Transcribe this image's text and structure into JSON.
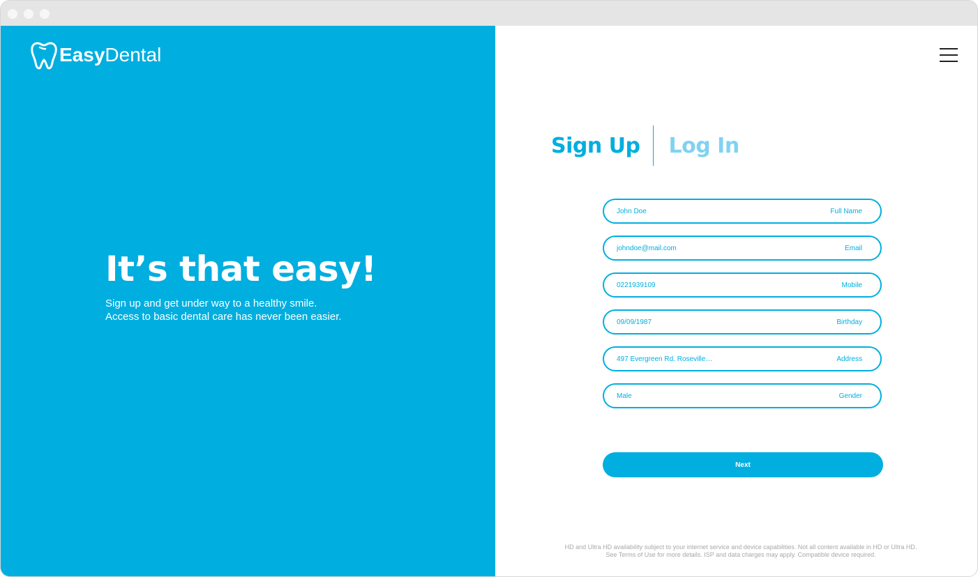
{
  "brand": {
    "name_bold": "Easy",
    "name_light": "Dental",
    "color": "#00aee0"
  },
  "hero": {
    "title": "It’s that easy!",
    "line1": "Sign up and get under way to a healthy smile.",
    "line2": "Access to basic dental care has never been easier."
  },
  "tabs": {
    "signup": "Sign Up",
    "login": "Log In",
    "active": "signup"
  },
  "menu": {
    "icon": "hamburger-icon"
  },
  "form": {
    "fields": [
      {
        "value": "John Doe",
        "label": "Full Name"
      },
      {
        "value": "johndoe@mail.com",
        "label": "Email"
      },
      {
        "value": "0221939109",
        "label": "Mobile"
      },
      {
        "value": "09/09/1987",
        "label": "Birthday"
      },
      {
        "value": "497 Evergreen Rd. Roseville…",
        "label": "Address"
      },
      {
        "value": "Male",
        "label": "Gender"
      }
    ],
    "submit": "Next"
  },
  "footer": {
    "line1": "HD and Ultra HD availability subject to your internet service and device capabilities. Not all content available in HD or Ultra HD.",
    "line2": "See Terms of Use for more details. ISP and data charges may apply. Compatible device required."
  }
}
